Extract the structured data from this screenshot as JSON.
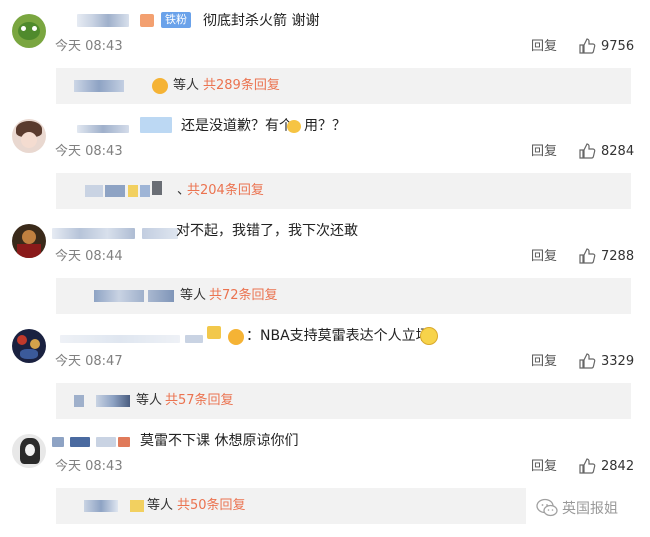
{
  "comments": [
    {
      "text": "彻底封杀火箭 谢谢",
      "badge": "铁粉",
      "time": "今天 08:43",
      "reply_label": "回复",
      "likes": "9756",
      "sub_suffix": "等人",
      "sub_link": "共289条回复"
    },
    {
      "text": "还是没道歉？有个",
      "text_after": "用？？",
      "time": "今天 08:43",
      "reply_label": "回复",
      "likes": "8284",
      "sub_suffix": "、",
      "sub_link": "共204条回复"
    },
    {
      "text": "对不起，我错了，我下次还敢",
      "time": "今天 08:44",
      "reply_label": "回复",
      "likes": "7288",
      "sub_suffix": "等人",
      "sub_link": "共72条回复"
    },
    {
      "text": "：NBA支持莫雷表达个人立场",
      "time": "今天 08:47",
      "reply_label": "回复",
      "likes": "3329",
      "sub_suffix": "等人",
      "sub_link": "共57条回复"
    },
    {
      "text": "莫雷不下课 休想原谅你们",
      "time": "今天 08:43",
      "reply_label": "回复",
      "likes": "2842",
      "sub_suffix": "等人",
      "sub_link": "共50条回复"
    }
  ],
  "watermark": {
    "text": "英国报姐",
    "icon": "wechat-icon"
  },
  "colors": {
    "link": "#eb7350",
    "badge": "#6aa2ea",
    "sub_bg": "#f2f2f2",
    "time": "#808080"
  }
}
